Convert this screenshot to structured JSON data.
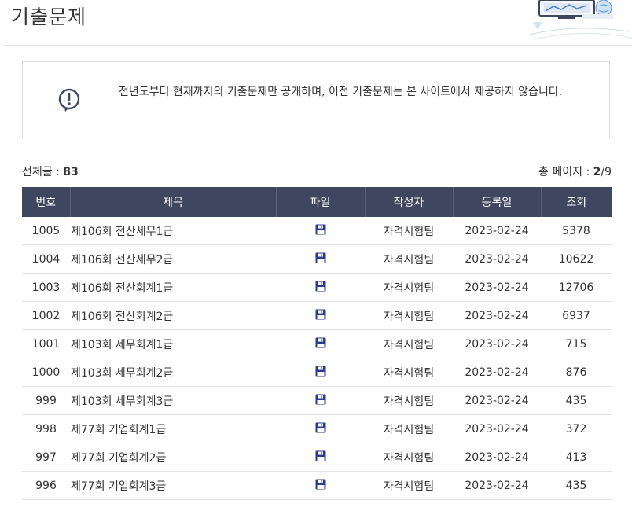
{
  "header": {
    "title": "기출문제"
  },
  "notice": {
    "icon": "exclamation-circle-icon",
    "text": "전년도부터 현재까지의 기출문제만 공개하며, 이전 기출문제는 본 사이트에서 제공하지 않습니다."
  },
  "summary": {
    "total_label": "전체글 : ",
    "total_value": "83",
    "page_label": "총 페이지 : ",
    "current_page": "2",
    "total_pages": "/9"
  },
  "table": {
    "columns": [
      "번호",
      "제목",
      "파일",
      "작성자",
      "등록일",
      "조회"
    ],
    "file_icon": "floppy-disk-icon",
    "rows": [
      {
        "no": "1005",
        "title": "제106회 전산세무1급",
        "author": "자격시험팀",
        "date": "2023-02-24",
        "views": "5378"
      },
      {
        "no": "1004",
        "title": "제106회 전산세무2급",
        "author": "자격시험팀",
        "date": "2023-02-24",
        "views": "10622"
      },
      {
        "no": "1003",
        "title": "제106회 전산회계1급",
        "author": "자격시험팀",
        "date": "2023-02-24",
        "views": "12706"
      },
      {
        "no": "1002",
        "title": "제106회 전산회계2급",
        "author": "자격시험팀",
        "date": "2023-02-24",
        "views": "6937"
      },
      {
        "no": "1001",
        "title": "제103회 세무회계1급",
        "author": "자격시험팀",
        "date": "2023-02-24",
        "views": "715"
      },
      {
        "no": "1000",
        "title": "제103회 세무회계2급",
        "author": "자격시험팀",
        "date": "2023-02-24",
        "views": "876"
      },
      {
        "no": "999",
        "title": "제103회 세무회계3급",
        "author": "자격시험팀",
        "date": "2023-02-24",
        "views": "435"
      },
      {
        "no": "998",
        "title": "제77회 기업회계1급",
        "author": "자격시험팀",
        "date": "2023-02-24",
        "views": "372"
      },
      {
        "no": "997",
        "title": "제77회 기업회계2급",
        "author": "자격시험팀",
        "date": "2023-02-24",
        "views": "413"
      },
      {
        "no": "996",
        "title": "제77회 기업회계3급",
        "author": "자격시험팀",
        "date": "2023-02-24",
        "views": "435"
      }
    ]
  },
  "colors": {
    "header_bg": "#3f4660",
    "file_icon": "#2b3a8c"
  }
}
